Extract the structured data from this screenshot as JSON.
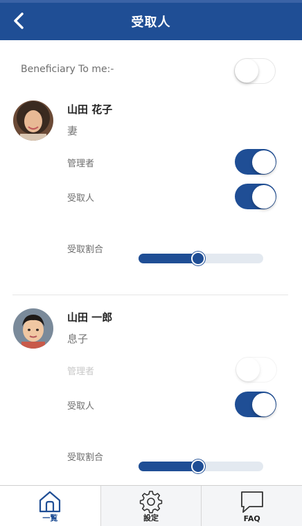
{
  "header": {
    "title": "受取人",
    "back_icon": "chevron-left-icon",
    "background": "#1f4e95"
  },
  "beneficiary_to_me": {
    "label": "Beneficiary To me:-",
    "enabled": false
  },
  "people": [
    {
      "name": "山田 花子",
      "relation": "妻",
      "admin_label": "管理者",
      "admin_on": true,
      "admin_disabled": false,
      "receiver_label": "受取人",
      "receiver_on": true,
      "share_label": "受取割合",
      "share_fraction": 0.48,
      "avatar": "woman-avatar"
    },
    {
      "name": "山田 一郎",
      "relation": "息子",
      "admin_label": "管理者",
      "admin_on": false,
      "admin_disabled": true,
      "receiver_label": "受取人",
      "receiver_on": true,
      "share_label": "受取割合",
      "share_fraction": 0.48,
      "avatar": "boy-avatar"
    }
  ],
  "tabs": [
    {
      "label": "一覧",
      "icon": "home-icon",
      "active": true
    },
    {
      "label": "設定",
      "icon": "gear-icon",
      "active": false
    },
    {
      "label": "FAQ",
      "icon": "chat-bubble-icon",
      "active": false
    }
  ],
  "colors": {
    "accent": "#1f4e95",
    "track": "#e3e9f0"
  }
}
